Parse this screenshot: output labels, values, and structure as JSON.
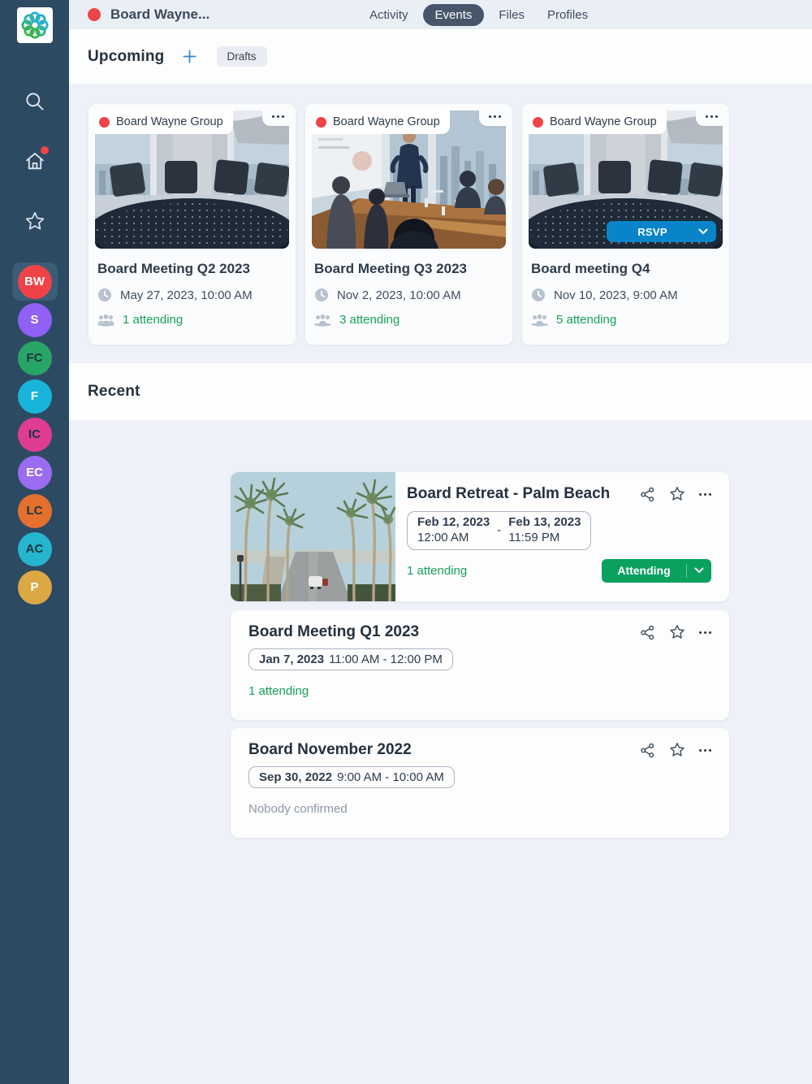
{
  "app": {
    "workspace_title": "Board Wayne..."
  },
  "header": {
    "tabs": [
      {
        "label": "Activity",
        "active": false
      },
      {
        "label": "Events",
        "active": true
      },
      {
        "label": "Files",
        "active": false
      },
      {
        "label": "Profiles",
        "active": false
      }
    ]
  },
  "sidebar": {
    "avatars": [
      {
        "initials": "BW",
        "color": "#ef4347",
        "text_color": "#ffffff",
        "selected": true
      },
      {
        "initials": "S",
        "color": "#9061f4",
        "text_color": "#ffffff",
        "selected": false
      },
      {
        "initials": "FC",
        "color": "#27a567",
        "text_color": "#1c3442",
        "selected": false
      },
      {
        "initials": "F",
        "color": "#18b4d9",
        "text_color": "#ffffff",
        "selected": false
      },
      {
        "initials": "IC",
        "color": "#de3d92",
        "text_color": "#1c3442",
        "selected": false
      },
      {
        "initials": "EC",
        "color": "#9a6cf2",
        "text_color": "#ffffff",
        "selected": false
      },
      {
        "initials": "LC",
        "color": "#e4702d",
        "text_color": "#1c3442",
        "selected": false
      },
      {
        "initials": "AC",
        "color": "#25b5cf",
        "text_color": "#1c3442",
        "selected": false
      },
      {
        "initials": "P",
        "color": "#dca844",
        "text_color": "#ffffff",
        "selected": false
      }
    ]
  },
  "upcoming": {
    "heading": "Upcoming",
    "drafts_label": "Drafts",
    "cards": [
      {
        "group": "Board Wayne Group",
        "title": "Board Meeting Q2 2023",
        "datetime": "May 27, 2023, 10:00 AM",
        "attendance": "1 attending"
      },
      {
        "group": "Board Wayne Group",
        "title": "Board Meeting Q3 2023",
        "datetime": "Nov 2, 2023, 10:00 AM",
        "attendance": "3 attending"
      },
      {
        "group": "Board Wayne Group",
        "title": "Board meeting Q4",
        "datetime": "Nov 10, 2023, 9:00 AM",
        "attendance": "5 attending",
        "rsvp_label": "RSVP"
      }
    ]
  },
  "recent": {
    "heading": "Recent",
    "cards": [
      {
        "title": "Board Retreat - Palm Beach",
        "date_start": "Feb 12, 2023",
        "time_start": "12:00 AM",
        "date_end": "Feb 13, 2023",
        "time_end": "11:59 PM",
        "range_dash": "-",
        "attendance": "1 attending",
        "button_label": "Attending"
      },
      {
        "title": "Board Meeting Q1 2023",
        "date": "Jan 7, 2023",
        "time_range": "11:00 AM - 12:00 PM",
        "attendance": "1 attending"
      },
      {
        "title": "Board November 2022",
        "date": "Sep 30, 2022",
        "time_range": "9:00 AM - 10:00 AM",
        "attendance": "Nobody confirmed"
      }
    ]
  },
  "colors": {
    "brand_red": "#ee4348",
    "sidebar_navy": "#2d4a63",
    "tab_active_bg": "#47566a",
    "rsvp_blue": "#0a84c9",
    "attending_button_green": "#0aa15e",
    "attending_text_green": "#16a05a"
  }
}
